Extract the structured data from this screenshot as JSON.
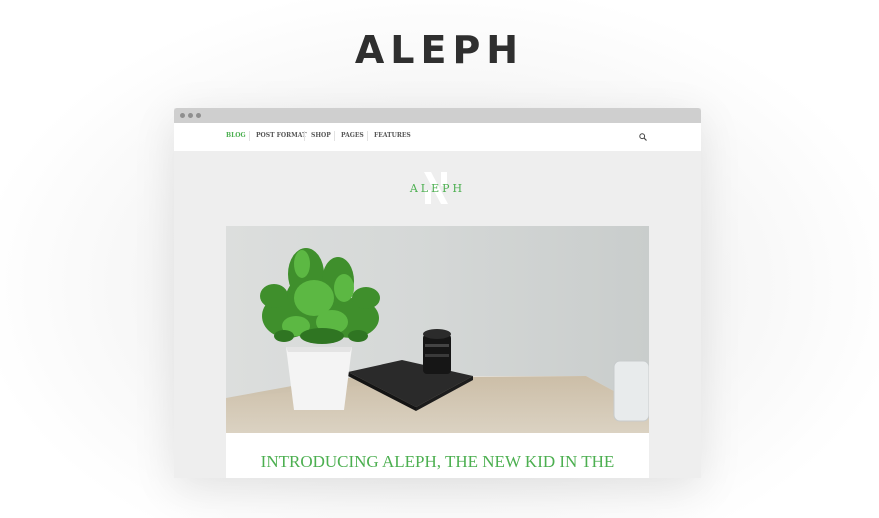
{
  "brand": {
    "title": "ALEPH"
  },
  "site": {
    "nav": [
      {
        "label": "BLOG",
        "active": true
      },
      {
        "label": "POST FORMAT",
        "active": false
      },
      {
        "label": "SHOP",
        "active": false
      },
      {
        "label": "PAGES",
        "active": false
      },
      {
        "label": "FEATURES",
        "active": false
      }
    ],
    "search_icon": "search-icon",
    "logo_text": "ALEPH",
    "accent_color": "#4caf50"
  },
  "post": {
    "title": "INTRODUCING ALEPH, THE NEW KID IN THE",
    "image": "plant-and-camera-lens-on-desk"
  }
}
